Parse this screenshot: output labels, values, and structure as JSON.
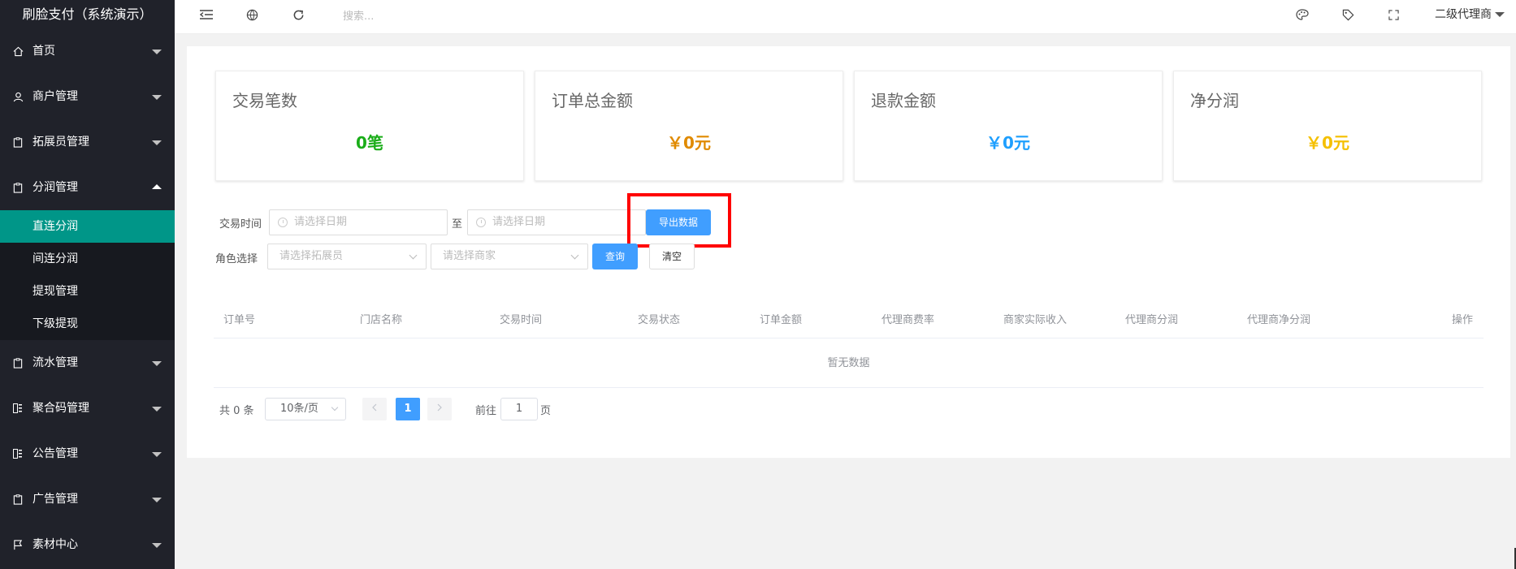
{
  "app": {
    "title": "刷脸支付（系统演示）"
  },
  "sidebar": {
    "items": [
      {
        "label": "首页",
        "icon": "home-icon"
      },
      {
        "label": "商户管理",
        "icon": "user-icon"
      },
      {
        "label": "拓展员管理",
        "icon": "clipboard-icon"
      },
      {
        "label": "分润管理",
        "icon": "clipboard-icon",
        "expanded": true,
        "children": [
          {
            "label": "直连分润",
            "active": true
          },
          {
            "label": "间连分润"
          },
          {
            "label": "提现管理"
          },
          {
            "label": "下级提现"
          }
        ]
      },
      {
        "label": "流水管理",
        "icon": "clipboard-icon"
      },
      {
        "label": "聚合码管理",
        "icon": "qrcode-icon"
      },
      {
        "label": "公告管理",
        "icon": "qrcode-icon"
      },
      {
        "label": "广告管理",
        "icon": "clipboard-icon"
      },
      {
        "label": "素材中心",
        "icon": "flag-icon"
      }
    ]
  },
  "header": {
    "search_placeholder": "搜索...",
    "user": "二级代理商"
  },
  "stats": [
    {
      "title": "交易笔数",
      "value": "0笔",
      "color": "#1aad19"
    },
    {
      "title": "订单总金额",
      "value": "￥0元",
      "color": "#e08a00"
    },
    {
      "title": "退款金额",
      "value": "￥0元",
      "color": "#1e9fff"
    },
    {
      "title": "净分润",
      "value": "￥0元",
      "color": "#f5c000"
    }
  ],
  "filters": {
    "time_label": "交易时间",
    "start_placeholder": "请选择日期",
    "to_label": "至",
    "end_placeholder": "请选择日期",
    "export_button": "导出数据",
    "role_label": "角色选择",
    "promoter_placeholder": "请选择拓展员",
    "merchant_placeholder": "请选择商家",
    "query_button": "查询",
    "clear_button": "清空"
  },
  "table": {
    "columns": [
      "订单号",
      "门店名称",
      "交易时间",
      "交易状态",
      "订单金额",
      "代理商费率",
      "商家实际收入",
      "代理商分润",
      "代理商净分润",
      "操作"
    ],
    "empty_text": "暂无数据"
  },
  "pagination": {
    "total_text": "共 0 条",
    "page_size": "10条/页",
    "current_page": "1",
    "goto_label": "前往",
    "goto_value": "1",
    "page_unit": "页"
  },
  "colors": {
    "sidebar_bg": "#20222a",
    "active": "#009688",
    "primary": "#409eff",
    "highlight": "#ff0000"
  }
}
